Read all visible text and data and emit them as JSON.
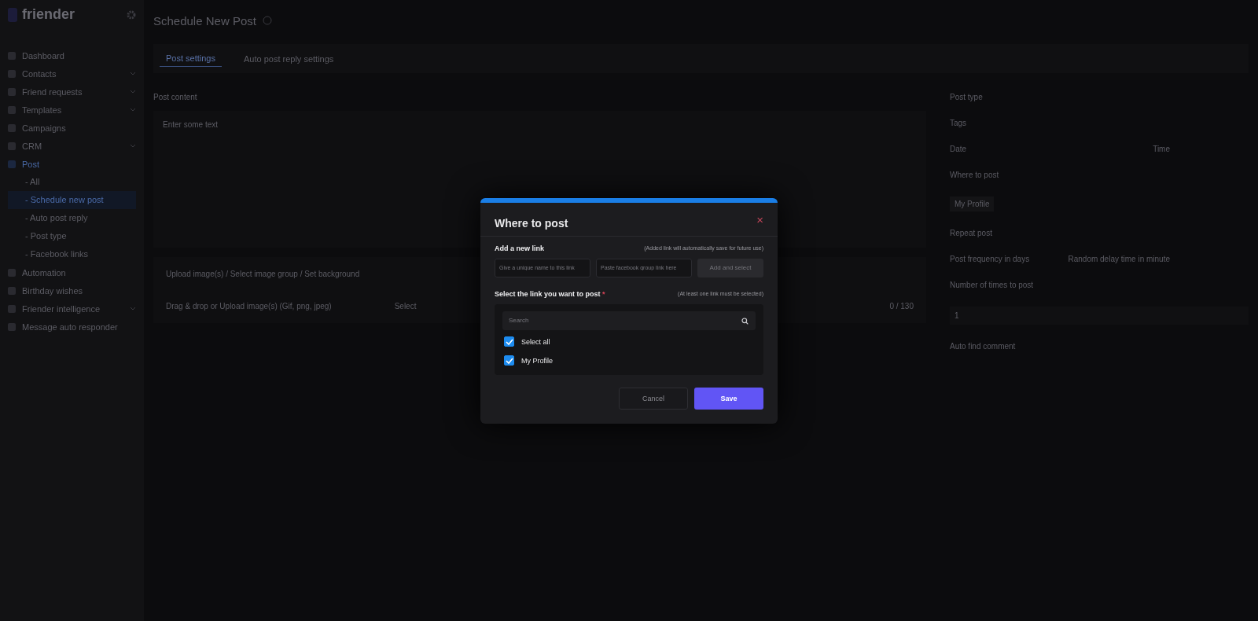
{
  "sidebar": {
    "logo": "friender",
    "items": [
      {
        "label": "Dashboard",
        "expandable": false,
        "active": false
      },
      {
        "label": "Contacts",
        "expandable": true,
        "active": false
      },
      {
        "label": "Friend requests",
        "expandable": true,
        "active": false
      },
      {
        "label": "Templates",
        "expandable": true,
        "active": false
      },
      {
        "label": "Campaigns",
        "expandable": false,
        "active": false
      },
      {
        "label": "CRM",
        "expandable": true,
        "active": false
      },
      {
        "label": "Post",
        "expandable": false,
        "active": true,
        "children": [
          {
            "label": "- All",
            "selected": false
          },
          {
            "label": "- Schedule new post",
            "selected": true
          },
          {
            "label": "- Auto post reply",
            "selected": false
          },
          {
            "label": "- Post type",
            "selected": false
          },
          {
            "label": "- Facebook links",
            "selected": false
          }
        ]
      },
      {
        "label": "Automation",
        "expandable": false,
        "active": false
      },
      {
        "label": "Birthday wishes",
        "expandable": false,
        "active": false
      },
      {
        "label": "Friender intelligence",
        "expandable": true,
        "active": false
      },
      {
        "label": "Message auto responder",
        "expandable": false,
        "active": false
      }
    ]
  },
  "header": {
    "title": "Schedule New Post"
  },
  "tabs": [
    {
      "label": "Post settings",
      "selected": true
    },
    {
      "label": "Auto post reply settings",
      "selected": false
    }
  ],
  "content": {
    "label": "Post content",
    "placeholder": "Enter some text",
    "upload_title": "Upload image(s) / Select image group / Set background",
    "drop_label": "Drag & drop or Upload image(s) (Gif, png, jpeg)",
    "select_label": "Select",
    "count": "0 / 130"
  },
  "settings": {
    "post_type": "Post type",
    "tags": "Tags",
    "date": "Date",
    "time": "Time",
    "where": "Where to post",
    "where_value": "My Profile",
    "repeat": "Repeat post",
    "frequency": "Post frequency in days",
    "delay": "Random delay time in minute",
    "times": "Number of times to post",
    "times_value": "1",
    "auto_comment": "Auto find comment"
  },
  "modal": {
    "title": "Where to post",
    "close": "×",
    "new_link": {
      "label": "Add a new link",
      "note": "(Added link will automatically save for future use)",
      "name_placeholder": "Give a unique name to this link",
      "url_placeholder": "Paste facebook group link here",
      "add_button": "Add and select"
    },
    "select": {
      "label": "Select the link you want to post",
      "required": "*",
      "note": "(At least one link must be selected)",
      "search_placeholder": "Search",
      "options": [
        {
          "label": "Select all",
          "checked": true
        },
        {
          "label": "My Profile",
          "checked": true
        }
      ]
    },
    "buttons": {
      "cancel": "Cancel",
      "save": "Save"
    }
  }
}
